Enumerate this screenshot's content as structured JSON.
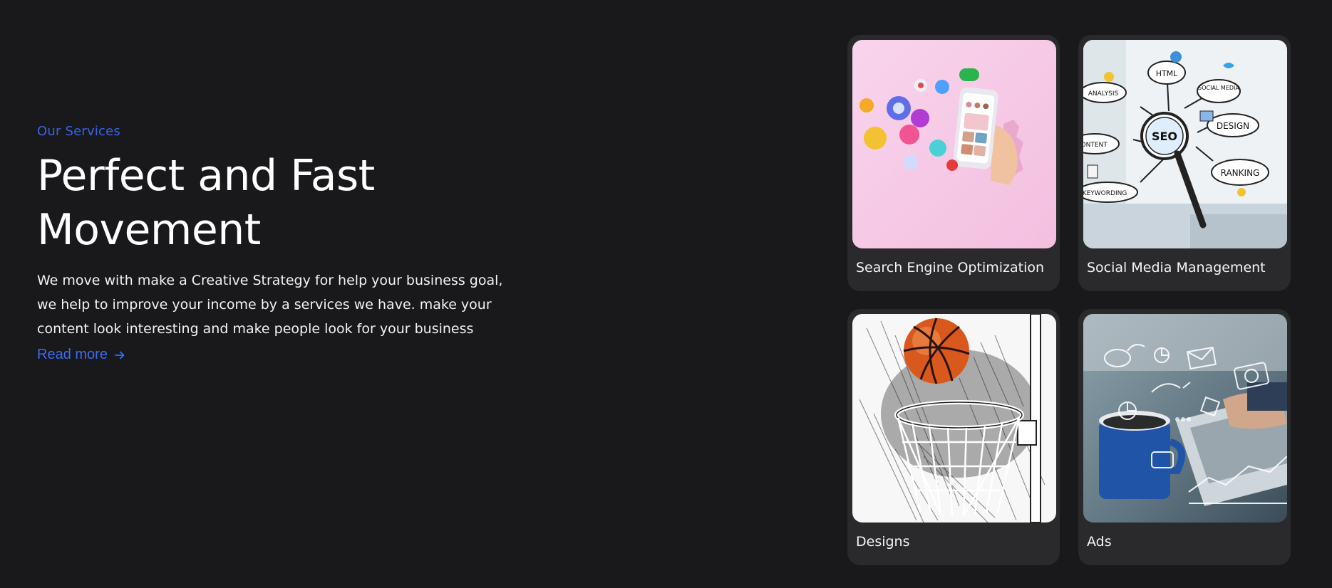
{
  "intro": {
    "eyebrow": "Our Services",
    "headline": "Perfect and Fast Movement",
    "description": "We move with make a Creative Strategy for help your business goal, we help to improve your income by a services we have. make your content look interesting and make people look for your business",
    "read_more": "Read more"
  },
  "services": [
    {
      "label": "Search Engine Optimization",
      "image": "phone-social-icons-illustration"
    },
    {
      "label": "Social Media Management",
      "image": "seo-magnifier-sketch"
    },
    {
      "label": "Designs",
      "image": "basketball-hoop-sketch"
    },
    {
      "label": "Ads",
      "image": "laptop-digital-marketing-photo"
    }
  ],
  "seo_sketch_words": [
    "ANALYSIS",
    "HTML",
    "SOCIAL MEDIA",
    "SEO",
    "DESIGN",
    "CONTENT",
    "RANKING",
    "KEYWORDING"
  ],
  "colors": {
    "background": "#19191b",
    "card": "#2a2a2c",
    "accent": "#3b63e6",
    "link": "#3b6cf0"
  }
}
